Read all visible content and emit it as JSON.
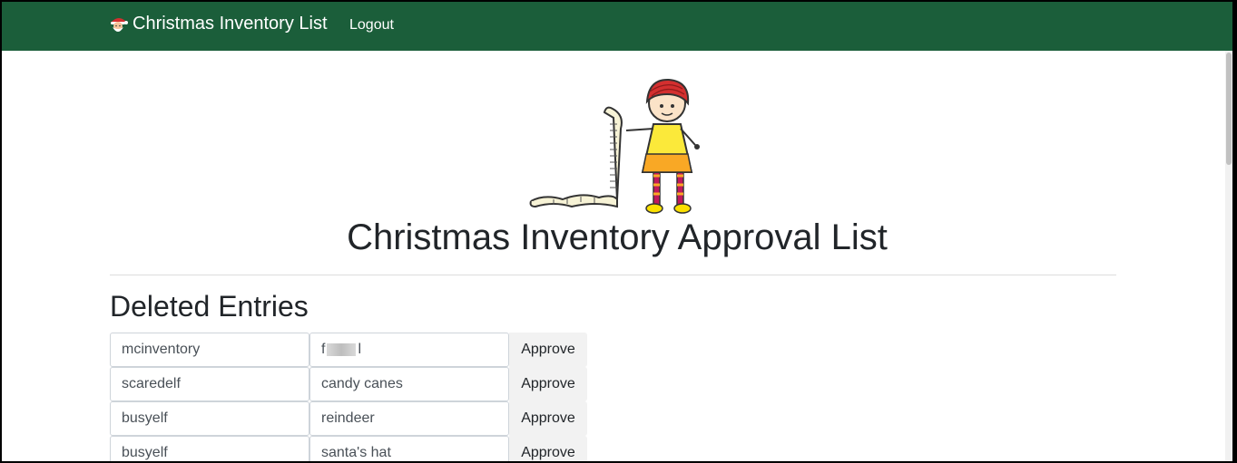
{
  "navbar": {
    "brand": "Christmas Inventory List",
    "logout": "Logout"
  },
  "page": {
    "title": "Christmas Inventory Approval List",
    "section_title": "Deleted Entries"
  },
  "entries": [
    {
      "user": "mcinventory",
      "item_prefix": "f",
      "item_suffix": "l",
      "item_redacted": true,
      "action": "Approve"
    },
    {
      "user": "scaredelf",
      "item": "candy canes",
      "action": "Approve"
    },
    {
      "user": "busyelf",
      "item": "reindeer",
      "action": "Approve"
    },
    {
      "user": "busyelf",
      "item": "santa's hat",
      "action": "Approve"
    }
  ],
  "colors": {
    "navbar": "#1b5e3a",
    "approve_bg": "#f2f2f2"
  },
  "icons": [
    "santa-icon",
    "elf-with-list-illustration"
  ]
}
